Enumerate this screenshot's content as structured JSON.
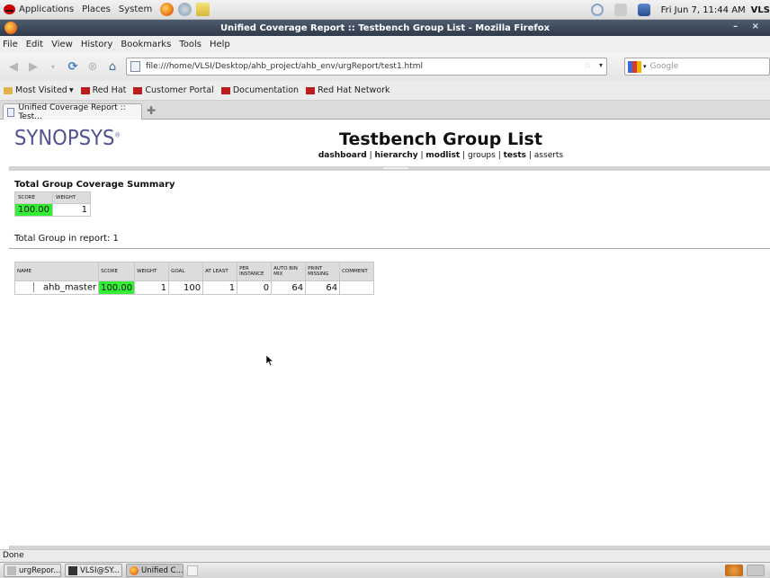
{
  "panel": {
    "menus": [
      "Applications",
      "Places",
      "System"
    ],
    "clock": "Fri Jun  7, 11:44 AM",
    "user": "VLS"
  },
  "window": {
    "title": "Unified Coverage Report :: Testbench Group List - Mozilla Firefox",
    "controls": "– ×"
  },
  "menubar": [
    "File",
    "Edit",
    "View",
    "History",
    "Bookmarks",
    "Tools",
    "Help"
  ],
  "navbar": {
    "url": "file:///home/VLSI/Desktop/ahb_project/ahb_env/urgReport/test1.html",
    "search_placeholder": "Google"
  },
  "bookmarks": [
    "Most Visited",
    "Red Hat",
    "Customer Portal",
    "Documentation",
    "Red Hat Network"
  ],
  "tab": {
    "title": "Unified Coverage Report :: Test..."
  },
  "page": {
    "logo": "SYNOPSYS",
    "title": "Testbench Group List",
    "nav": {
      "dashboard": "dashboard",
      "hierarchy": "hierarchy",
      "modlist": "modlist",
      "groups": "groups",
      "tests": "tests",
      "asserts": "asserts"
    },
    "summary": {
      "title": "Total Group Coverage Summary",
      "headers": [
        "SCORE",
        "WEIGHT"
      ],
      "score": "100.00",
      "weight": "1"
    },
    "total_groups": "Total Group in report: 1",
    "group_table": {
      "headers": [
        "NAME",
        "SCORE",
        "WEIGHT",
        "GOAL",
        "AT LEAST",
        "PER INSTANCE",
        "AUTO BIN MIX",
        "PRINT MISSING",
        "COMMENT"
      ],
      "rows": [
        {
          "name": "ahb_master",
          "score": "100.00",
          "weight": "1",
          "goal": "100",
          "at_least": "1",
          "per_instance": "0",
          "auto_bin": "64",
          "print_missing": "64",
          "comment": ""
        }
      ]
    }
  },
  "status": "Done",
  "taskbar": [
    "urgRepor...",
    "VLSI@SY...",
    "Unified C..."
  ]
}
